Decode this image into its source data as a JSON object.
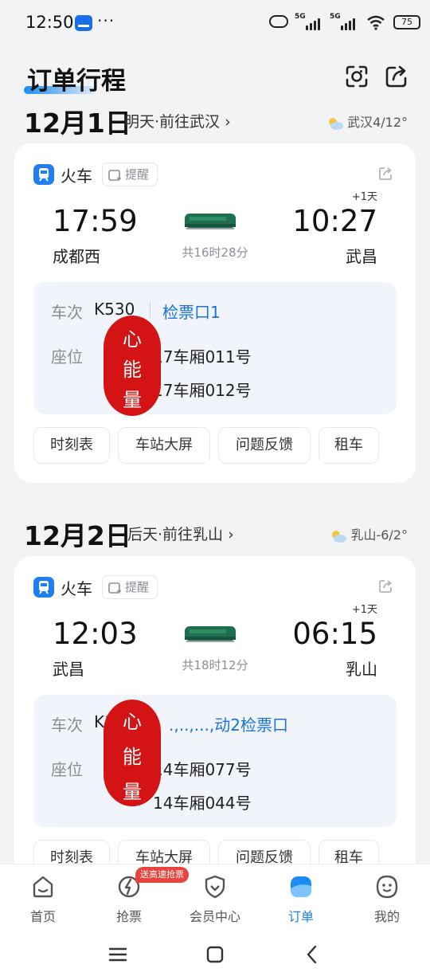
{
  "status_bar": {
    "time": "12:50",
    "dots": "···",
    "signal_1": "5G",
    "signal_2": "5G",
    "battery": "75"
  },
  "header": {
    "title": "订单行程",
    "camera_icon": "camera-icon",
    "share_icon": "share-icon"
  },
  "days": [
    {
      "date": "12月1日",
      "subtitle": "明天·前往武汉 ›",
      "weather": "武汉4/12°",
      "trip": {
        "type": "火车",
        "remind": "提醒",
        "plus_day": "+1天",
        "dep_time": "17:59",
        "arr_time": "10:27",
        "dep_station": "成都西",
        "arr_station": "武昌",
        "duration": "共16时28分",
        "train_label": "车次",
        "train_no": "K530",
        "gate": "检票口1",
        "seat_label": "座位",
        "seats": [
          "17车厢011号",
          "17车厢012号"
        ],
        "stamp": [
          "心",
          "能",
          "量"
        ],
        "actions": [
          "时刻表",
          "车站大屏",
          "问题反馈",
          "租车"
        ]
      }
    },
    {
      "date": "12月2日",
      "subtitle": "后天·前往乳山 ›",
      "weather": "乳山-6/2°",
      "trip": {
        "type": "火车",
        "remind": "提醒",
        "plus_day": "+1天",
        "dep_time": "12:03",
        "arr_time": "06:15",
        "dep_station": "武昌",
        "arr_station": "乳山",
        "duration": "共18时12分",
        "train_label": "车次",
        "train_no": "K1068",
        "gate": ".,..,...,动2检票口",
        "seat_label": "座位",
        "seats": [
          "14车厢077号",
          "14车厢044号"
        ],
        "stamp": [
          "心",
          "能",
          "量"
        ],
        "actions": [
          "时刻表",
          "车站大屏",
          "问题反馈",
          "租车"
        ]
      }
    }
  ],
  "bottom_nav": {
    "items": [
      {
        "label": "首页",
        "icon": "home-icon"
      },
      {
        "label": "抢票",
        "icon": "ticket-grab-icon"
      },
      {
        "label": "会员中心",
        "icon": "member-icon"
      },
      {
        "label": "订单",
        "icon": "order-icon"
      },
      {
        "label": "我的",
        "icon": "profile-icon"
      }
    ],
    "active": "订单",
    "promo_badge": "送高速抢票"
  },
  "colors": {
    "accent": "#1b7ff0",
    "gate_text": "#1973d8",
    "stamp": "#d41414",
    "background": "#f2f3f5",
    "promo": "#e8443b"
  }
}
